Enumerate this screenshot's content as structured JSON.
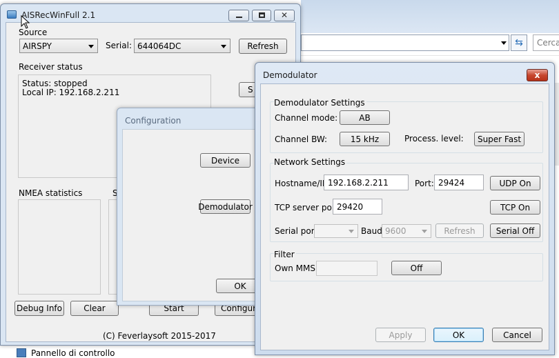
{
  "background": {
    "search_placeholder": "Cerca",
    "taskbar_item": "Pannello di controllo"
  },
  "main": {
    "title": "AISRecWinFull 2.1",
    "source_label": "Source",
    "source_value": "AIRSPY",
    "serial_label": "Serial:",
    "serial_value": "644064DC",
    "refresh_label": "Refresh",
    "receiver_status_label": "Receiver status",
    "status_line": "Status: stopped",
    "ip_line": "Local IP: 192.168.2.211",
    "nmea_label": "NMEA statistics",
    "st_label": "St",
    "debug_label": "Debug Info",
    "clear_label": "Clear",
    "start_partial": "S",
    "hidden_btn1": "Start",
    "hidden_btn2": "Configuration",
    "copyright": "(C) Feverlaysoft 2015-2017"
  },
  "configuration": {
    "title": "Configuration",
    "device_label": "Device",
    "demodulator_label": "Demodulator",
    "ok_label": "OK"
  },
  "demodulator": {
    "title": "Demodulator",
    "close_glyph": "x",
    "settings_group": "Demodulator Settings",
    "channel_mode_label": "Channel mode:",
    "channel_mode_value": "AB",
    "channel_bw_label": "Channel BW:",
    "channel_bw_value": "15 kHz",
    "process_level_label": "Process. level:",
    "process_level_value": "Super Fast",
    "network_group": "Network Settings",
    "hostname_label": "Hostname/IP:",
    "hostname_value": "192.168.2.211",
    "port_label": "Port:",
    "port_value": "29424",
    "udp_label": "UDP On",
    "tcp_port_label": "TCP server port:",
    "tcp_port_value": "29420",
    "tcp_label": "TCP On",
    "serial_port_label": "Serial port:",
    "baud_label": "Baud:",
    "baud_value": "9600",
    "refresh_label": "Refresh",
    "serial_off_label": "Serial Off",
    "filter_group": "Filter",
    "own_mmsi_label": "Own MMSI:",
    "filter_off_label": "Off",
    "apply_label": "Apply",
    "ok_label": "OK",
    "cancel_label": "Cancel"
  }
}
